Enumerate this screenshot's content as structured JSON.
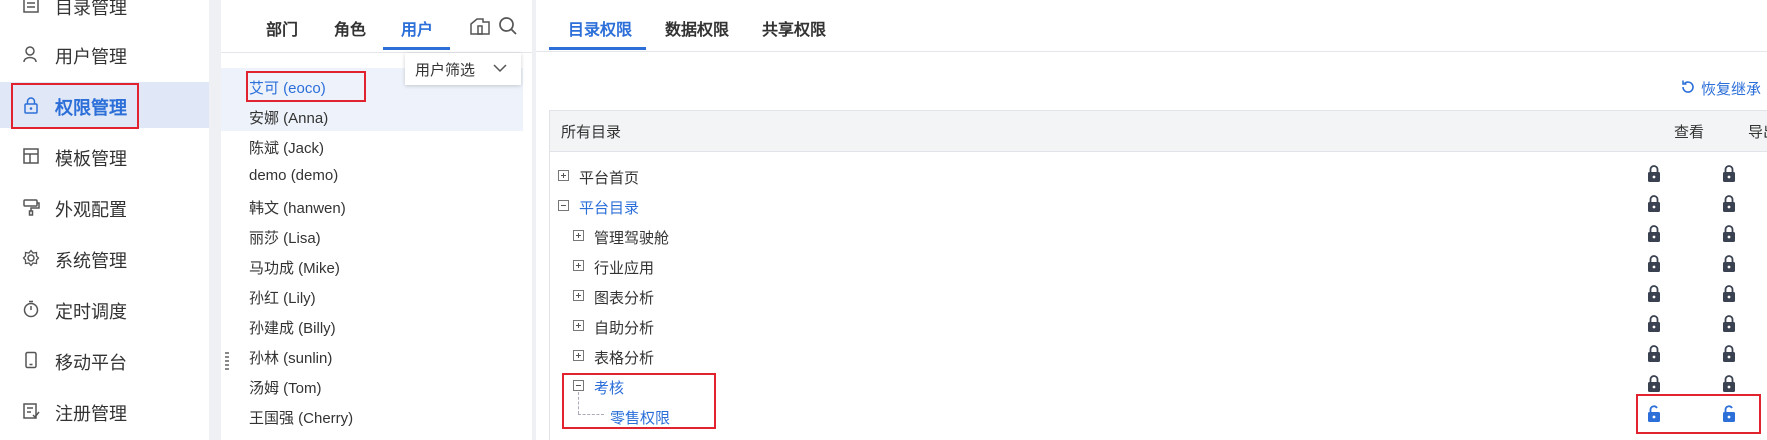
{
  "sidebar": {
    "items": [
      {
        "label": "目录管理",
        "icon": "directory-icon"
      },
      {
        "label": "用户管理",
        "icon": "user-icon"
      },
      {
        "label": "权限管理",
        "icon": "lock-icon"
      },
      {
        "label": "模板管理",
        "icon": "template-icon"
      },
      {
        "label": "外观配置",
        "icon": "brush-icon"
      },
      {
        "label": "系统管理",
        "icon": "gear-icon"
      },
      {
        "label": "定时调度",
        "icon": "timer-icon"
      },
      {
        "label": "移动平台",
        "icon": "mobile-icon"
      },
      {
        "label": "注册管理",
        "icon": "register-icon"
      }
    ]
  },
  "user_panel": {
    "tabs": [
      {
        "label": "部门"
      },
      {
        "label": "角色"
      },
      {
        "label": "用户"
      }
    ],
    "filter_label": "用户筛选",
    "users": [
      "艾可 (eoco)",
      "安娜 (Anna)",
      "陈斌 (Jack)",
      "demo (demo)",
      "韩文 (hanwen)",
      "丽莎 (Lisa)",
      "马功成 (Mike)",
      "孙红 (Lily)",
      "孙建成 (Billy)",
      "孙林 (sunlin)",
      "汤姆 (Tom)",
      "王国强 (Cherry)"
    ]
  },
  "perm_panel": {
    "tabs": [
      {
        "label": "目录权限"
      },
      {
        "label": "数据权限"
      },
      {
        "label": "共享权限"
      }
    ],
    "restore_label": "恢复继承",
    "header": {
      "all": "所有目录",
      "view": "查看",
      "export": "导出"
    },
    "rows": [
      {
        "label": "平台首页",
        "view": "locked",
        "export": "locked"
      },
      {
        "label": "平台目录",
        "view": "locked",
        "export": "locked"
      },
      {
        "label": "管理驾驶舱",
        "view": "locked",
        "export": "locked"
      },
      {
        "label": "行业应用",
        "view": "locked",
        "export": "locked"
      },
      {
        "label": "图表分析",
        "view": "locked",
        "export": "locked"
      },
      {
        "label": "自助分析",
        "view": "locked",
        "export": "locked"
      },
      {
        "label": "表格分析",
        "view": "locked",
        "export": "locked"
      },
      {
        "label": "考核",
        "view": "locked",
        "export": "locked"
      },
      {
        "label": "零售权限",
        "view": "unlocked",
        "export": "unlocked"
      }
    ]
  },
  "colors": {
    "accent": "#2c6fd9",
    "highlight": "#e0232f",
    "lock": "#3a4150"
  }
}
